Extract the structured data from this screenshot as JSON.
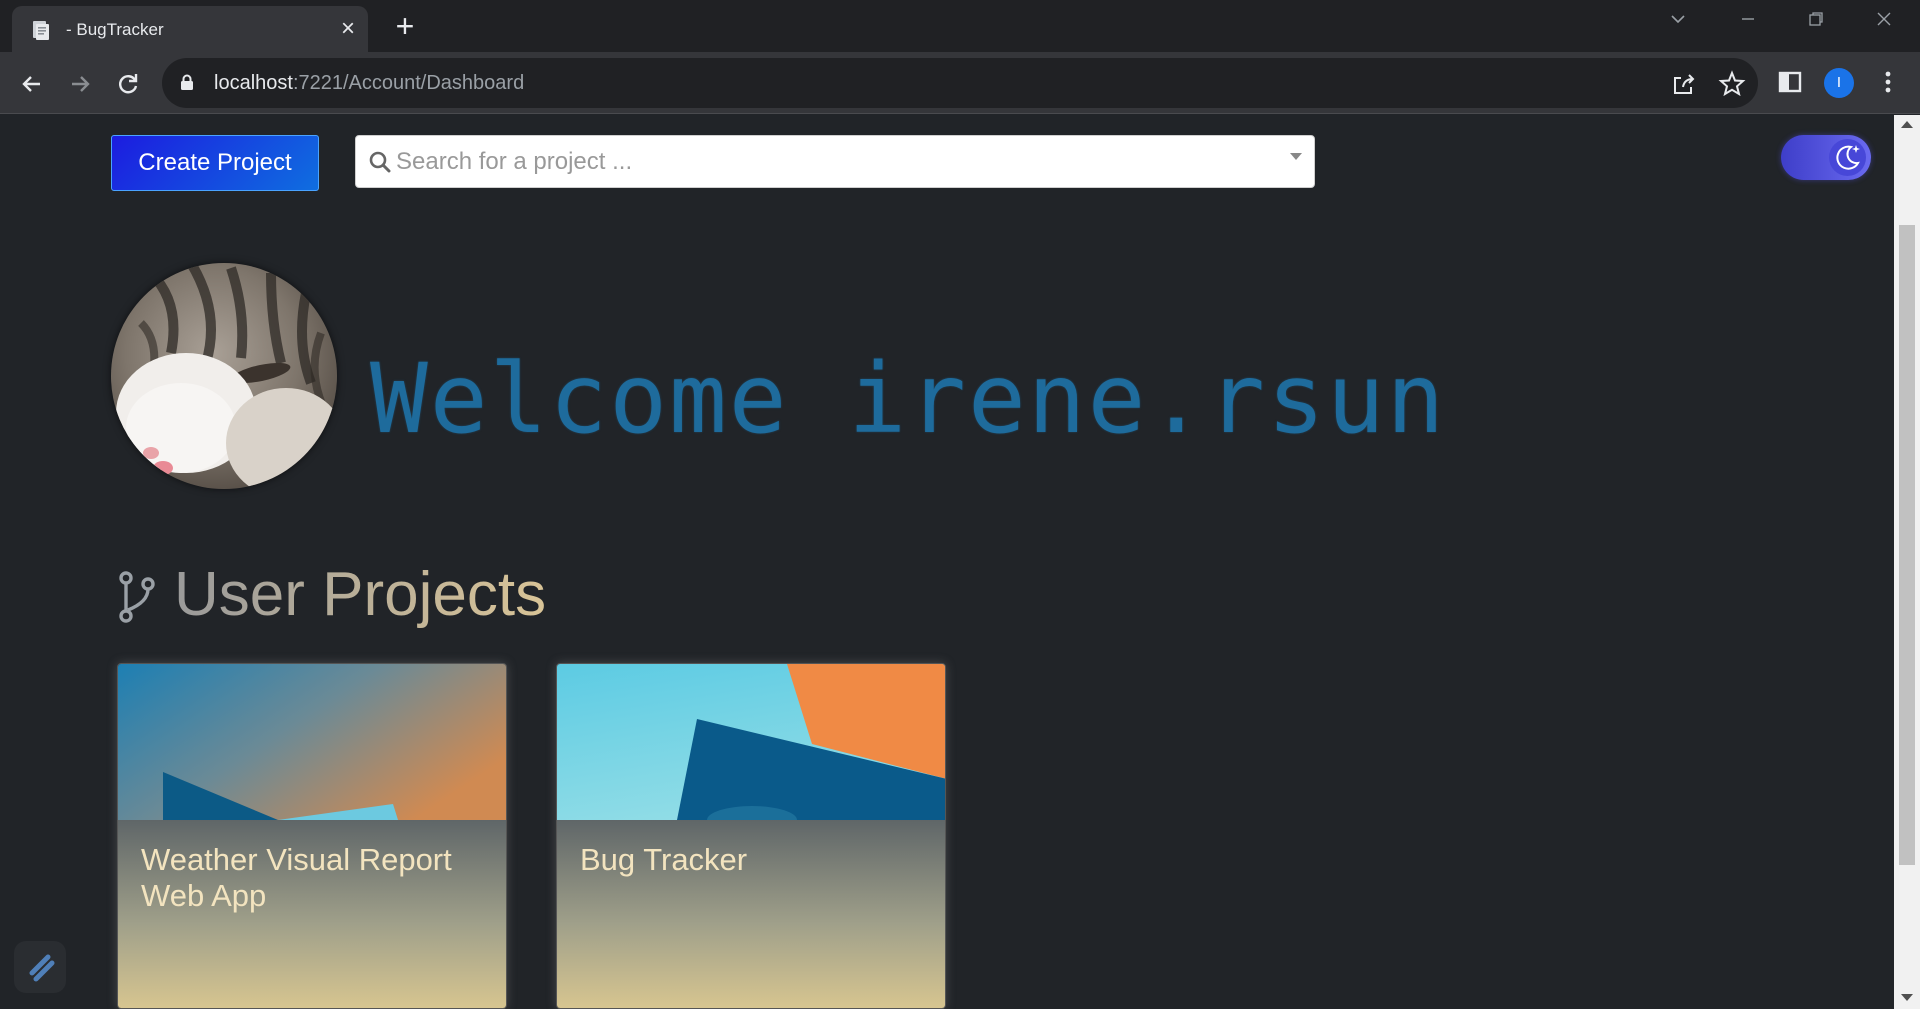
{
  "browser": {
    "tab_title": "- BugTracker",
    "url_host": "localhost",
    "url_rest": ":7221/Account/Dashboard",
    "profile_initial": "I"
  },
  "toolbar": {
    "create_project_label": "Create Project",
    "search_placeholder": "Search for a project ..."
  },
  "welcome": {
    "text": "Welcome irene.rsun"
  },
  "projects": {
    "section_title": "User Projects",
    "items": [
      {
        "title": "Weather Visual Report Web App"
      },
      {
        "title": "Bug Tracker"
      }
    ]
  },
  "colors": {
    "page_bg": "#212428",
    "welcome_text": "#1e6b9c",
    "create_button": "#1c1ce0",
    "toggle": "#4747d8",
    "card_title": "#f3e4bf"
  },
  "icons": {
    "theme_toggle": "moon-stars-icon",
    "section": "git-branch-icon",
    "search": "search-icon"
  }
}
